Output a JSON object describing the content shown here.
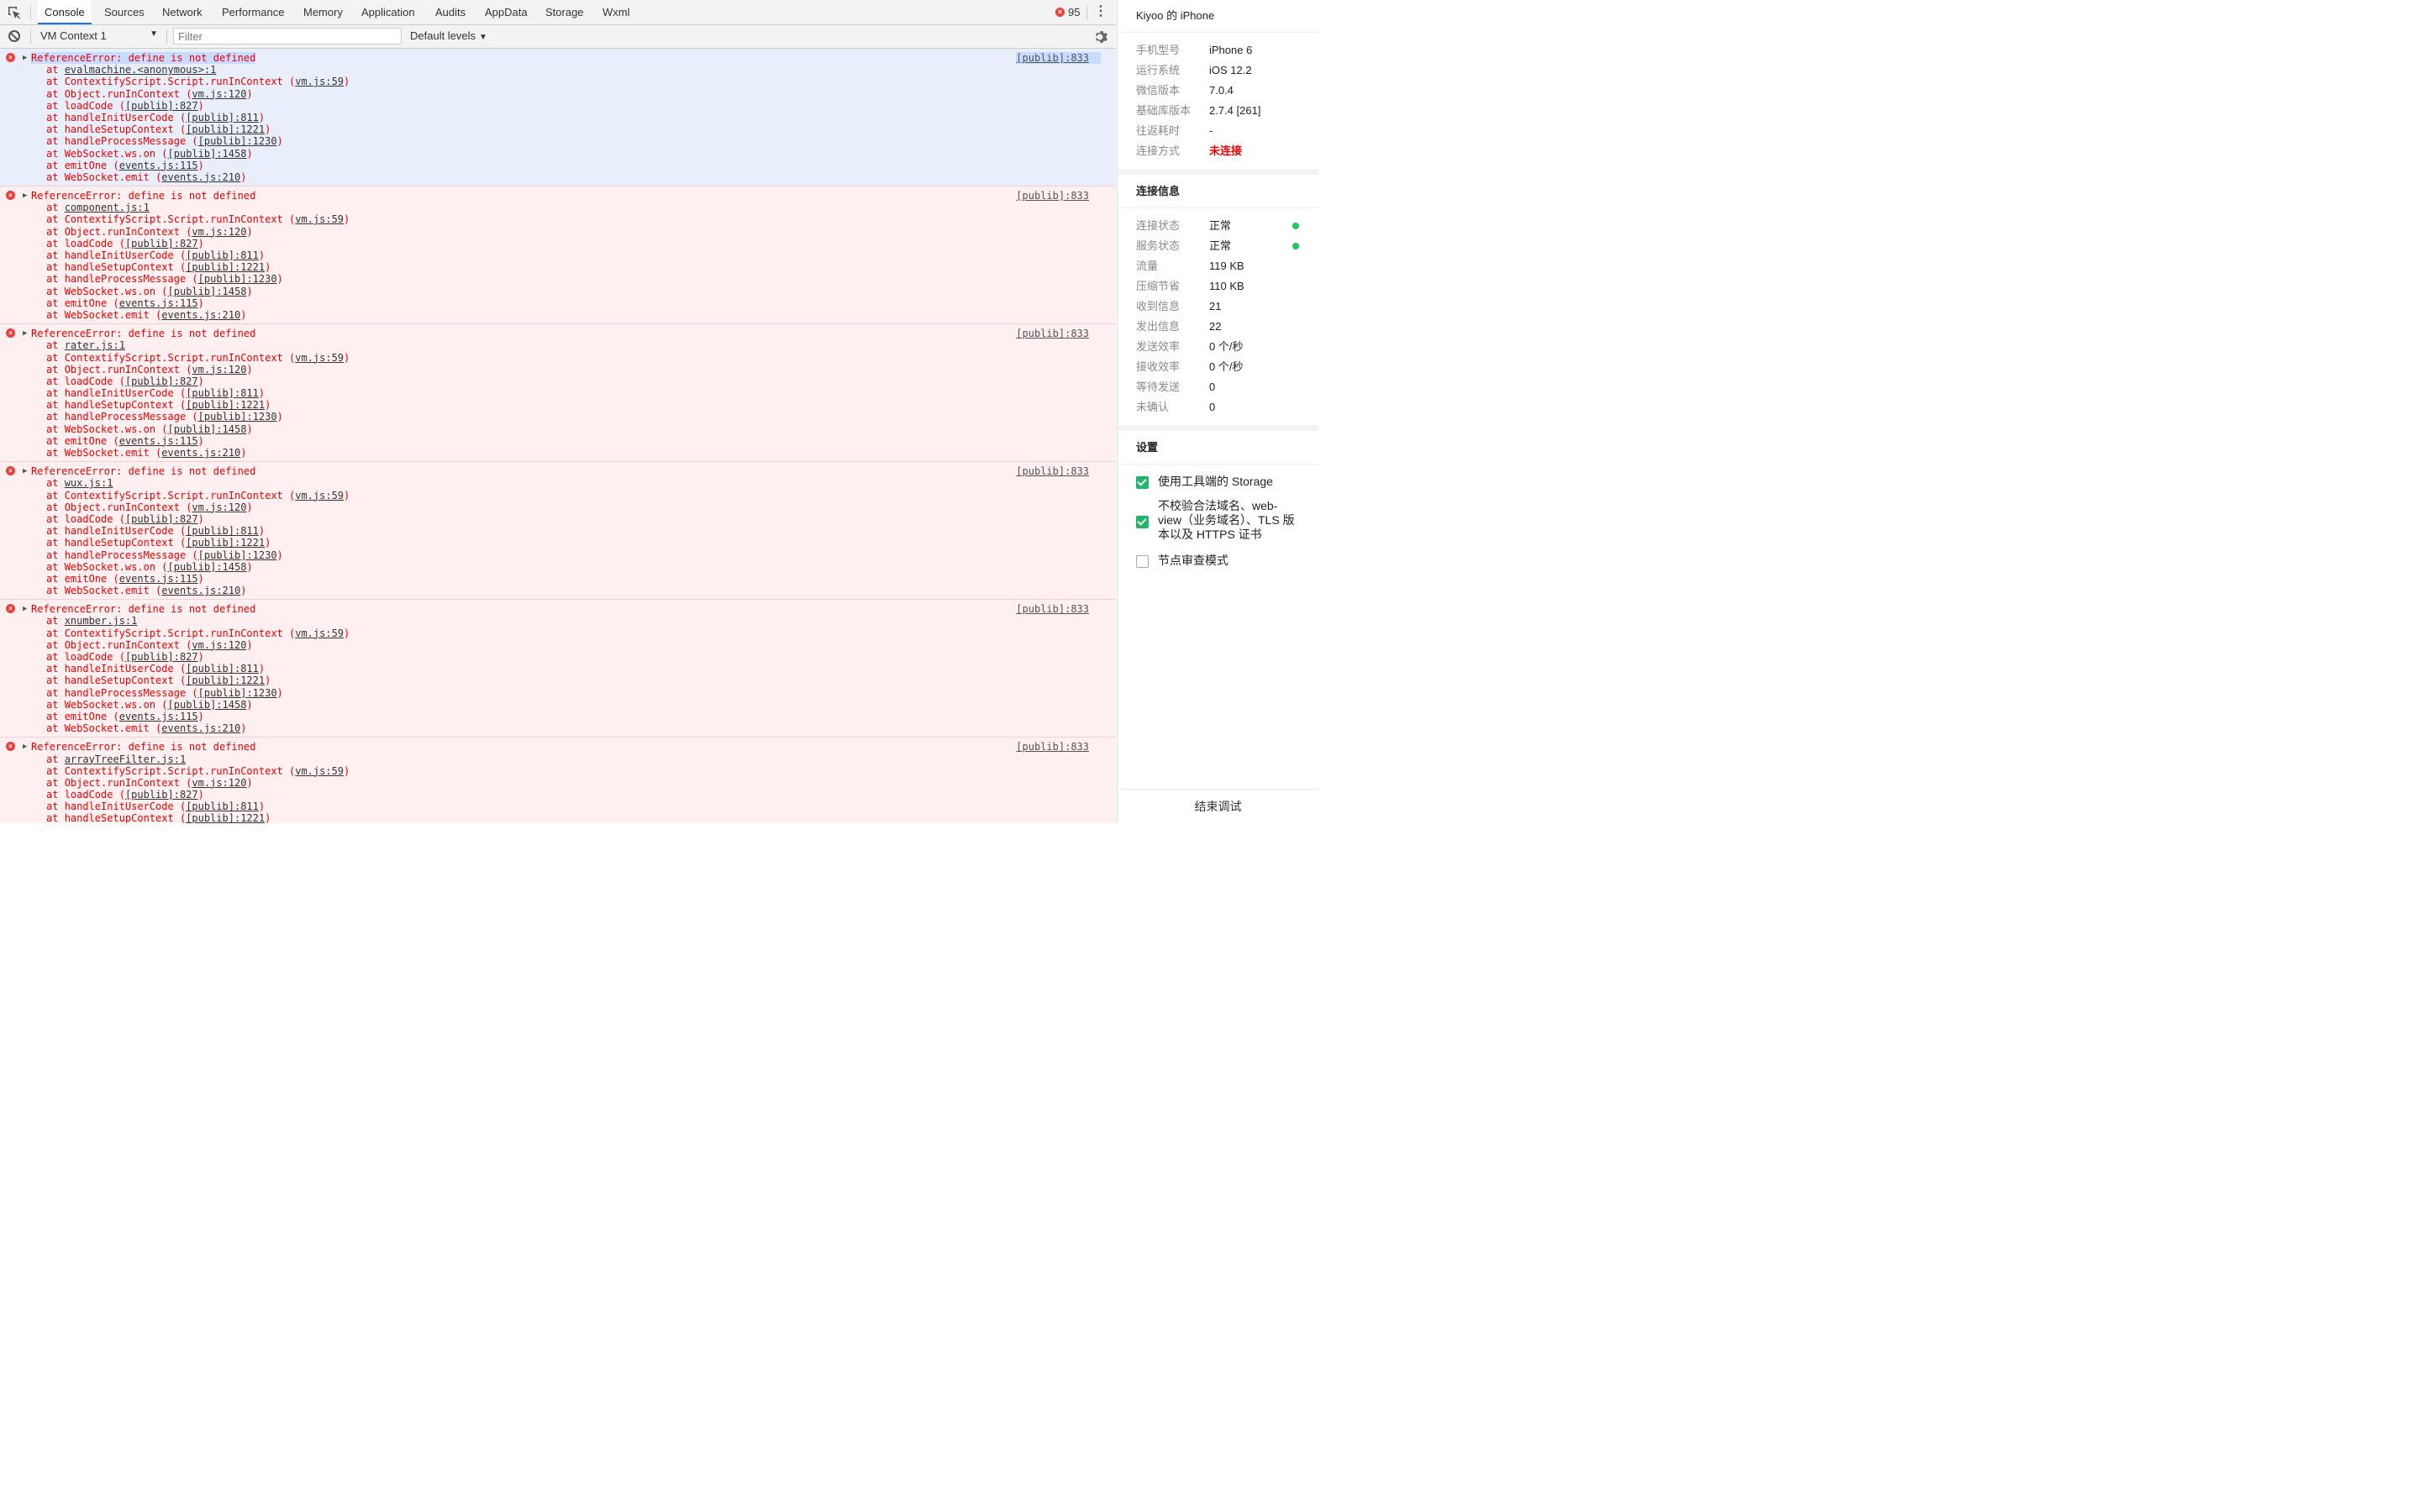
{
  "tabs": [
    "Console",
    "Sources",
    "Network",
    "Performance",
    "Memory",
    "Application",
    "Audits",
    "AppData",
    "Storage",
    "Wxml"
  ],
  "error_count": "95",
  "toolbar": {
    "context": "VM Context 1",
    "filter_placeholder": "Filter",
    "levels": "Default levels"
  },
  "messages": [
    {
      "title": "ReferenceError: define is not defined",
      "source": "[publib]:833",
      "first_frame": "evalmachine.<anonymous>:1",
      "selected": true
    },
    {
      "title": "ReferenceError: define is not defined",
      "source": "[publib]:833",
      "first_frame": "component.js:1",
      "selected": false
    },
    {
      "title": "ReferenceError: define is not defined",
      "source": "[publib]:833",
      "first_frame": "rater.js:1",
      "selected": false
    },
    {
      "title": "ReferenceError: define is not defined",
      "source": "[publib]:833",
      "first_frame": "wux.js:1",
      "selected": false
    },
    {
      "title": "ReferenceError: define is not defined",
      "source": "[publib]:833",
      "first_frame": "xnumber.js:1",
      "selected": false
    },
    {
      "title": "ReferenceError: define is not defined",
      "source": "[publib]:833",
      "first_frame": "arrayTreeFilter.js:1",
      "selected": false
    }
  ],
  "stack_frames": [
    {
      "fn": "ContextifyScript.Script.runInContext",
      "loc": "vm.js:59"
    },
    {
      "fn": "Object.runInContext",
      "loc": "vm.js:120"
    },
    {
      "fn": "loadCode",
      "loc": "[publib]:827"
    },
    {
      "fn": "handleInitUserCode",
      "loc": "[publib]:811"
    },
    {
      "fn": "handleSetupContext",
      "loc": "[publib]:1221"
    },
    {
      "fn": "handleProcessMessage",
      "loc": "[publib]:1230"
    },
    {
      "fn": "WebSocket.ws.on",
      "loc": "[publib]:1458"
    },
    {
      "fn": "emitOne",
      "loc": "events.js:115"
    },
    {
      "fn": "WebSocket.emit",
      "loc": "events.js:210"
    }
  ],
  "sidebar": {
    "device": "Kiyoo 的 iPhone",
    "device_info": [
      {
        "k": "手机型号",
        "v": "iPhone 6"
      },
      {
        "k": "运行系统",
        "v": "iOS 12.2"
      },
      {
        "k": "微信版本",
        "v": "7.0.4"
      },
      {
        "k": "基础库版本",
        "v": "2.7.4 [261]"
      },
      {
        "k": "往返耗时",
        "v": "-"
      },
      {
        "k": "连接方式",
        "v": "未连接"
      }
    ],
    "conn_title": "连接信息",
    "conn_info": [
      {
        "k": "连接状态",
        "v": "正常",
        "dot": true
      },
      {
        "k": "服务状态",
        "v": "正常",
        "dot": true
      },
      {
        "k": "流量",
        "v": "119 KB"
      },
      {
        "k": "压缩节省",
        "v": "110 KB"
      },
      {
        "k": "收到信息",
        "v": "21"
      },
      {
        "k": "发出信息",
        "v": "22"
      },
      {
        "k": "发送效率",
        "v": "0 个/秒"
      },
      {
        "k": "接收效率",
        "v": "0 个/秒"
      },
      {
        "k": "等待发送",
        "v": "0"
      },
      {
        "k": "未确认",
        "v": "0"
      }
    ],
    "settings_title": "设置",
    "settings": [
      {
        "label": "使用工具端的 Storage",
        "checked": true
      },
      {
        "label": "不校验合法域名、web-view（业务域名）、TLS 版本以及 HTTPS 证书",
        "checked": true
      },
      {
        "label": "节点审查模式",
        "checked": false
      }
    ],
    "end_button": "结束调试"
  },
  "colors": {
    "error": "#e00",
    "accent": "#1a73e8",
    "success": "#1fb66a"
  }
}
